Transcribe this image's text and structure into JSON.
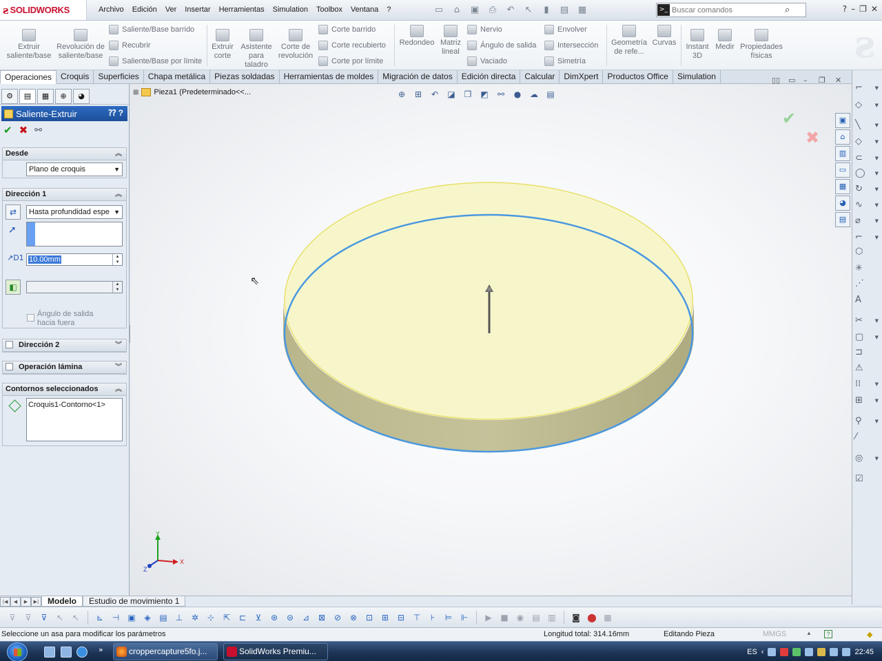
{
  "app": {
    "logo_text": "SOLIDWORKS",
    "menu": [
      "Archivo",
      "Edición",
      "Ver",
      "Insertar",
      "Herramientas",
      "Simulation",
      "Toolbox",
      "Ventana",
      "?"
    ],
    "search_placeholder": "Buscar comandos"
  },
  "ribbon": {
    "extruir_saliente": "Extruir saliente/base",
    "revolucion_saliente": "Revolución de saliente/base",
    "saliente_barrido": "Saliente/Base barrido",
    "recubrir": "Recubrir",
    "saliente_limite": "Saliente/Base por límite",
    "extruir_corte": "Extruir corte",
    "asistente_taladro": "Asistente para taladro",
    "corte_revolucion": "Corte de revolución",
    "corte_barrido": "Corte barrido",
    "corte_recubierto": "Corte recubierto",
    "corte_limite": "Corte por límite",
    "redondeo": "Redondeo",
    "matriz_lineal": "Matriz lineal",
    "nervio": "Nervio",
    "angulo_salida": "Ángulo de salida",
    "vaciado": "Vaciado",
    "envolver": "Envolver",
    "interseccion": "Intersección",
    "simetria": "Simetría",
    "geometria_ref": "Geometría de refe...",
    "curvas": "Curvas",
    "instant3d": "Instant 3D",
    "medir": "Medir",
    "propiedades_fisicas": "Propiedades físicas"
  },
  "tabs": [
    "Operaciones",
    "Croquis",
    "Superficies",
    "Chapa metálica",
    "Piezas soldadas",
    "Herramientas de moldes",
    "Migración de datos",
    "Edición directa",
    "Calcular",
    "DimXpert",
    "Productos Office",
    "Simulation"
  ],
  "property_manager": {
    "title": "Saliente-Extruir",
    "desde": {
      "header": "Desde",
      "value": "Plano de croquis"
    },
    "direccion1": {
      "header": "Dirección 1",
      "end_condition": "Hasta profundidad espe",
      "depth": "10.00mm",
      "draft_label": "Ángulo de salida hacia fuera"
    },
    "direccion2": {
      "header": "Dirección 2"
    },
    "operacion_lamina": {
      "header": "Operación lámina"
    },
    "contornos": {
      "header": "Contornos seleccionados",
      "item": "Croquis1-Contorno<1>"
    }
  },
  "graphics": {
    "tree_label": "Pieza1  (Predeterminado<<...",
    "triad": {
      "y": "Y",
      "x": "X",
      "z": "Z"
    }
  },
  "model_tabs": [
    "Modelo",
    "Estudio de movimiento 1"
  ],
  "status": {
    "message": "Seleccione un asa para modificar los parámetros",
    "length": "Longitud total: 314.16mm",
    "mode": "Editando Pieza",
    "units": "MMGS"
  },
  "taskbar": {
    "item1": "croppercapture5fo.j...",
    "item2": "SolidWorks Premiu...",
    "lang": "ES",
    "time": "22:45"
  },
  "colors": {
    "accent": "#2d6bc3",
    "solid_face": "#f7f6c8",
    "edge": "#4a98e0"
  }
}
